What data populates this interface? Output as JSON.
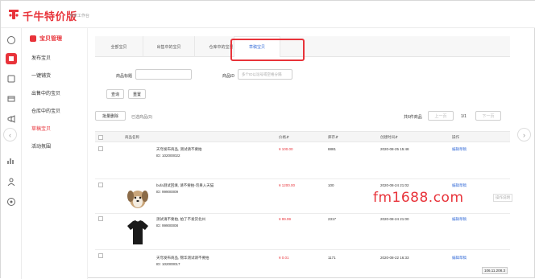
{
  "app": {
    "title": "千牛特价版",
    "subtitle": "卖家工作台"
  },
  "sidebar": {
    "section_title": "宝贝管理",
    "items": [
      {
        "label": "发布宝贝",
        "active": false
      },
      {
        "label": "一键铺货",
        "active": false
      },
      {
        "label": "出售中的宝贝",
        "active": false
      },
      {
        "label": "仓库中的宝贝",
        "active": false
      },
      {
        "label": "草稿宝贝",
        "active": true
      },
      {
        "label": "活动氛围",
        "active": false
      }
    ]
  },
  "iconbar": {
    "icons": [
      "home-icon",
      "goods-icon",
      "order-icon",
      "shop-icon",
      "marketing-icon",
      "data-icon",
      "user-icon",
      "settings-icon"
    ]
  },
  "tabs": [
    {
      "label": "全部宝贝",
      "active": false
    },
    {
      "label": "出售中的宝贝",
      "active": false
    },
    {
      "label": "仓库中的宝贝",
      "active": false
    },
    {
      "label": "草稿宝贝",
      "active": true
    }
  ],
  "filters": {
    "title_label": "商品标题",
    "title_value": "",
    "id_label": "商品ID",
    "id_placeholder": "多个ID以逗号或空格分隔",
    "search_button": "查询",
    "reset_button": "重置"
  },
  "toolbar": {
    "batch_delete": "批量删除",
    "selected_text": "已选商品(0)",
    "total_text": "共6件商品",
    "prev_page": "上一页",
    "page_info": "1/1",
    "next_page": "下一页"
  },
  "table": {
    "headers": [
      "商品名称",
      "价格⇵",
      "库存⇵",
      "创建时间⇵",
      "操作"
    ],
    "rows": [
      {
        "title": "天穹发布商品, 测试请不要拍",
        "id": "ID: 102000022",
        "price": "¥ 100.00",
        "stock": "8881",
        "created": "2020-08-25 15:48",
        "action": "编辑草稿",
        "thumb": "none"
      },
      {
        "title": "bufa测试回填, 请不要拍-勿果入天猫",
        "id": "ID: 99900009",
        "price": "¥ 1200.00",
        "stock": "100",
        "created": "2020-08-24 21:02",
        "action": "编辑草稿",
        "thumb": "dog"
      },
      {
        "title": "测试请不要拍, 拍了不发货北州",
        "id": "ID: 99900008",
        "price": "¥ 99.99",
        "stock": "2317",
        "created": "2020-08-24 21:00",
        "action": "编辑草稿",
        "thumb": "tshirt"
      },
      {
        "title": "天穹发布商品, 锦华测试请不要拍",
        "id": "ID: 102000017",
        "price": "¥ 0.01",
        "stock": "1171",
        "created": "2020-08-22 16:33",
        "action": "编辑草稿",
        "thumb": "none"
      }
    ]
  },
  "watermark": "fm1688.com",
  "side_tag": "操作说明",
  "ip_badge": "106.11.208.3",
  "colors": {
    "brand": "#e8333a",
    "link": "#3a6fd8"
  }
}
